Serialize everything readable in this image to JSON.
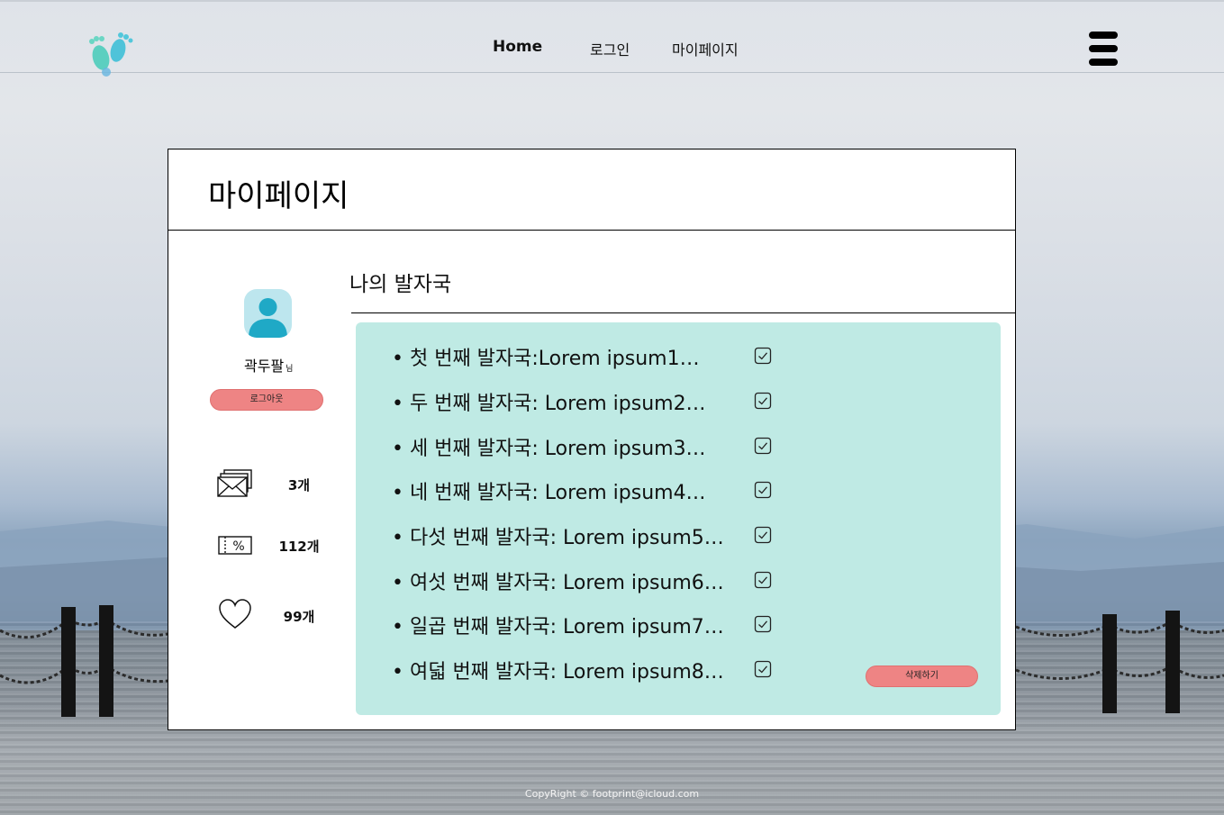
{
  "header": {
    "nav": [
      {
        "label": "Home"
      },
      {
        "label": "로그인"
      },
      {
        "label": "마이페이지"
      }
    ]
  },
  "page": {
    "title": "마이페이지"
  },
  "profile": {
    "name": "곽두팔",
    "name_suffix": "님",
    "logout_label": "로그아웃",
    "stats": [
      {
        "icon": "mail-icon",
        "value": "3개"
      },
      {
        "icon": "coupon-icon",
        "value": "112개"
      },
      {
        "icon": "heart-icon",
        "value": "99개"
      }
    ]
  },
  "footprints": {
    "title": "나의 발자국",
    "items": [
      {
        "text": "• 첫 번째 발자국:Lorem ipsum1…",
        "checked": true
      },
      {
        "text": "• 두 번째 발자국: Lorem ipsum2…",
        "checked": true
      },
      {
        "text": "• 세 번째 발자국: Lorem ipsum3…",
        "checked": true
      },
      {
        "text": "• 네 번째 발자국: Lorem ipsum4…",
        "checked": true
      },
      {
        "text": "• 다섯 번째 발자국: Lorem ipsum5…",
        "checked": true
      },
      {
        "text": "• 여섯 번째 발자국: Lorem ipsum6…",
        "checked": true
      },
      {
        "text": "• 일곱 번째 발자국: Lorem ipsum7…",
        "checked": true
      },
      {
        "text": "• 여덟 번째 발자국: Lorem ipsum8…",
        "checked": true
      }
    ],
    "delete_label": "삭제하기"
  },
  "footer": {
    "text": "CopyRight © footprint@icloud.com"
  },
  "colors": {
    "accent_button": "#ee8484",
    "panel_bg": "#bfeae4",
    "avatar_bg": "#bde6ee",
    "avatar_fg": "#1fa9c6"
  }
}
